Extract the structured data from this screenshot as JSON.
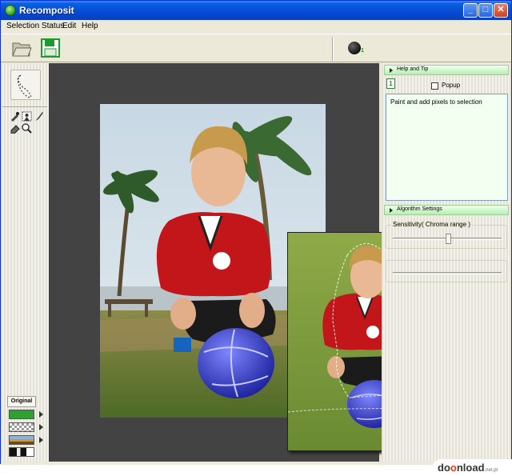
{
  "window": {
    "title": "Recomposit"
  },
  "title_buttons": {
    "minimize": "_",
    "maximize": "□",
    "close": "✕"
  },
  "menu": [
    "Selection Status",
    "Edit",
    "Help"
  ],
  "toolbar": {
    "open_icon": "folder-open-icon",
    "save_icon": "save-disk-icon",
    "status_count": "1"
  },
  "left_tools": {
    "lasso": "lasso-icon",
    "row1": [
      "eyedropper-icon",
      "select-person-icon",
      "brush-icon"
    ],
    "row2": [
      "eraser-icon",
      "zoom-icon"
    ],
    "original_tab": "Original",
    "backgrounds": [
      "green-fill",
      "transparent-checker",
      "landscape-image",
      "silhouette-image"
    ]
  },
  "help": {
    "header": "Help and Tip",
    "popup_label": "Popup",
    "popup_checked": false,
    "text": "Paint and add pixels to selection"
  },
  "algorithm": {
    "header": "Algorithm Settings",
    "sensitivity_label": "Sensitivity( Chroma range )"
  },
  "watermark": {
    "pre": "do",
    "o": "o",
    "post": "nload",
    "suffix": ".net.pl"
  },
  "colors": {
    "accent_green": "#b9eeb1",
    "titlebar_blue": "#0549d6",
    "canvas": "#434343"
  }
}
